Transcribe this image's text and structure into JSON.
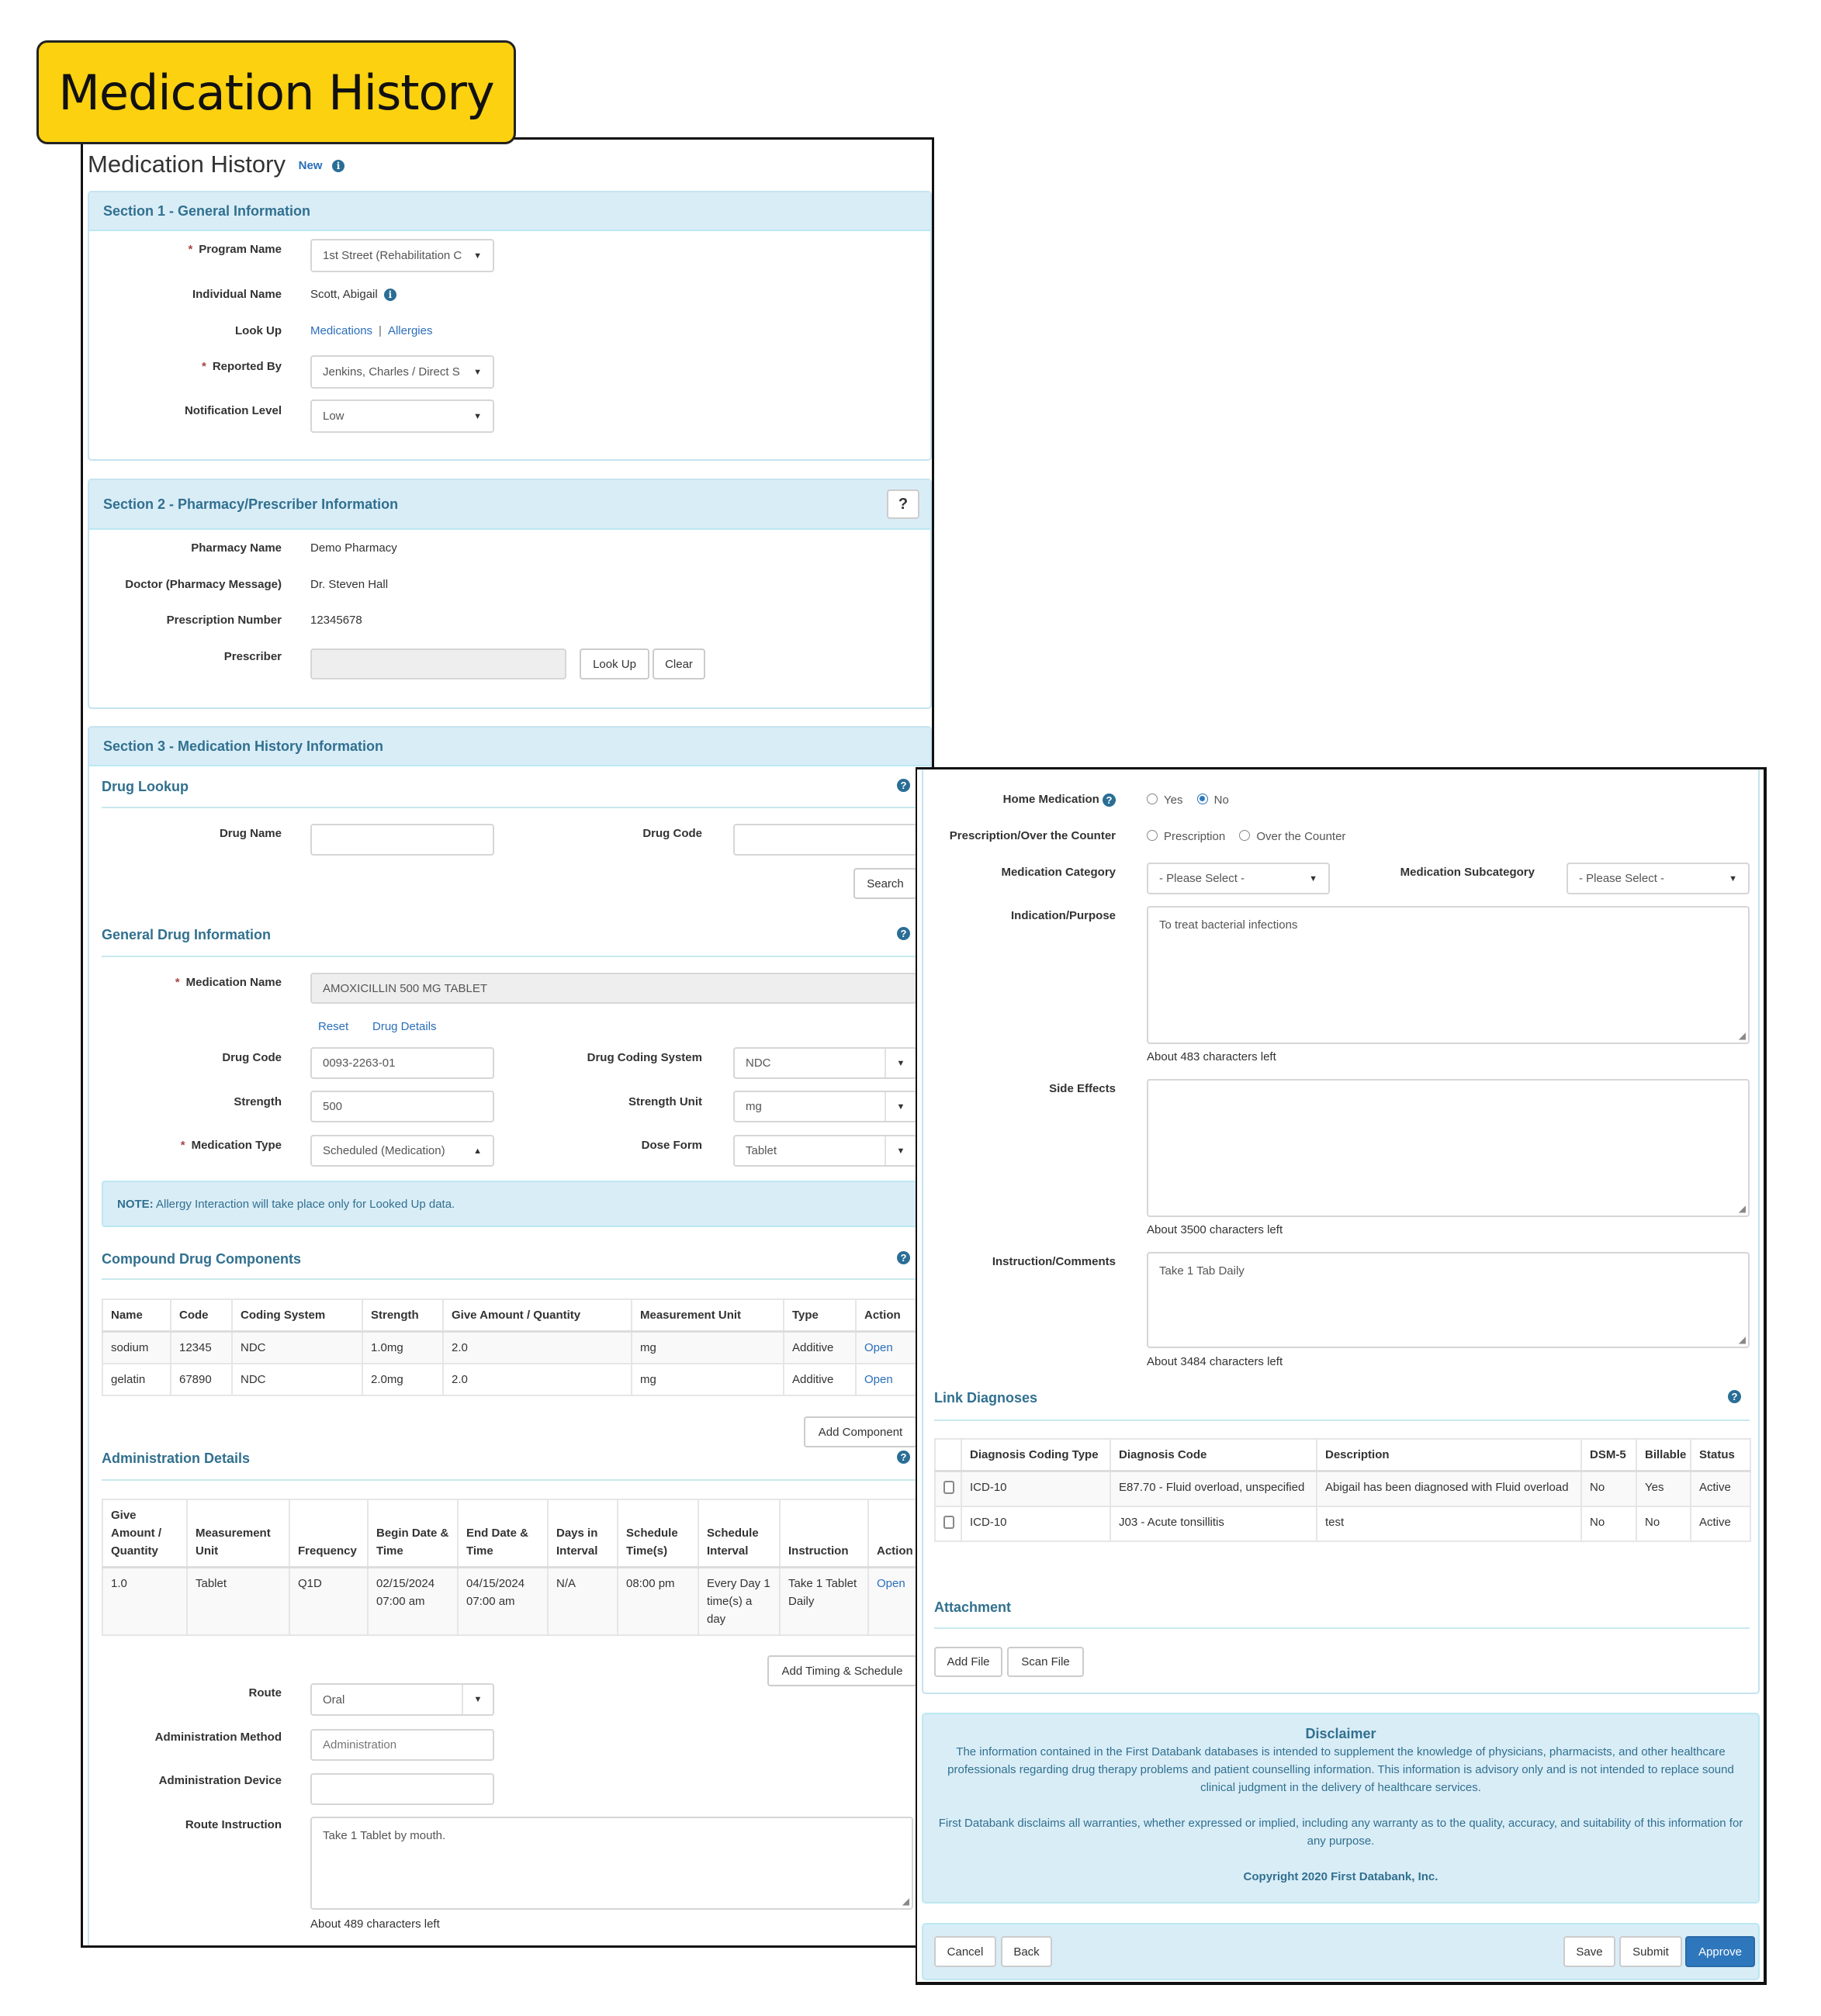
{
  "callout": {
    "title": "Medication History"
  },
  "page": {
    "title": "Medication History",
    "badge": "New"
  },
  "section1": {
    "title": "Section 1 - General Information",
    "program_name": {
      "label": "Program Name",
      "value": "1st Street (Rehabilitation C"
    },
    "individual_name": {
      "label": "Individual Name",
      "value": "Scott, Abigail"
    },
    "look_up": {
      "label": "Look Up",
      "links": [
        "Medications",
        "Allergies"
      ],
      "separator": "|"
    },
    "reported_by": {
      "label": "Reported By",
      "value": "Jenkins, Charles / Direct S"
    },
    "notification_level": {
      "label": "Notification Level",
      "value": "Low"
    }
  },
  "section2": {
    "title": "Section 2 - Pharmacy/Prescriber Information",
    "help_label": "?",
    "pharmacy_name": {
      "label": "Pharmacy Name",
      "value": "Demo Pharmacy"
    },
    "doctor": {
      "label": "Doctor (Pharmacy Message)",
      "value": "Dr. Steven Hall"
    },
    "prescription_number": {
      "label": "Prescription Number",
      "value": "12345678"
    },
    "prescriber": {
      "label": "Prescriber",
      "value": "",
      "lookup_button": "Look Up",
      "clear_button": "Clear"
    }
  },
  "section3": {
    "title": "Section 3 - Medication History Information",
    "drug_lookup": {
      "title": "Drug Lookup",
      "drug_name_label": "Drug Name",
      "drug_name_value": "",
      "drug_code_label": "Drug Code",
      "drug_code_value": "",
      "search_button": "Search"
    },
    "general": {
      "title": "General Drug Information",
      "medication_name": {
        "label": "Medication Name",
        "value": "AMOXICILLIN 500 MG TABLET"
      },
      "reset_link": "Reset",
      "drug_details_link": "Drug Details",
      "drug_code": {
        "label": "Drug Code",
        "value": "0093-2263-01"
      },
      "drug_coding_system": {
        "label": "Drug Coding System",
        "value": "NDC"
      },
      "strength": {
        "label": "Strength",
        "value": "500"
      },
      "strength_unit": {
        "label": "Strength Unit",
        "value": "mg"
      },
      "medication_type": {
        "label": "Medication Type",
        "value": "Scheduled (Medication)"
      },
      "dose_form": {
        "label": "Dose Form",
        "value": "Tablet"
      },
      "note_label": "NOTE:",
      "note_text": " Allergy Interaction will take place only for Looked Up data."
    },
    "compound": {
      "title": "Compound Drug Components",
      "columns": [
        "Name",
        "Code",
        "Coding System",
        "Strength",
        "Give Amount / Quantity",
        "Measurement Unit",
        "Type",
        "Action"
      ],
      "rows": [
        [
          "sodium",
          "12345",
          "NDC",
          "1.0mg",
          "2.0",
          "mg",
          "Additive",
          "Open"
        ],
        [
          "gelatin",
          "67890",
          "NDC",
          "2.0mg",
          "2.0",
          "mg",
          "Additive",
          "Open"
        ]
      ],
      "add_button": "Add Component"
    },
    "administration": {
      "title": "Administration Details",
      "columns": [
        "Give Amount / Quantity",
        "Measurement Unit",
        "Frequency",
        "Begin Date & Time",
        "End Date & Time",
        "Days in Interval",
        "Schedule Time(s)",
        "Schedule Interval",
        "Instruction",
        "Action"
      ],
      "rows": [
        [
          "1.0",
          "Tablet",
          "Q1D",
          "02/15/2024 07:00 am",
          "04/15/2024 07:00 am",
          "N/A",
          "08:00 pm",
          "Every Day 1 time(s) a day",
          "Take 1 Tablet Daily",
          "Open"
        ]
      ],
      "add_button": "Add Timing & Schedule",
      "route": {
        "label": "Route",
        "value": "Oral"
      },
      "method": {
        "label": "Administration Method",
        "value": "",
        "placeholder": "Administration"
      },
      "device": {
        "label": "Administration Device",
        "value": ""
      },
      "route_instruction": {
        "label": "Route Instruction",
        "value": "Take 1 Tablet by mouth."
      },
      "route_instruction_hint": "About 489 characters left"
    }
  },
  "right": {
    "home_medication": {
      "label": "Home Medication",
      "options": [
        "Yes",
        "No"
      ],
      "selected": "No"
    },
    "rx_otc": {
      "label": "Prescription/Over the Counter",
      "options": [
        "Prescription",
        "Over the Counter"
      ],
      "selected": null
    },
    "category": {
      "label": "Medication Category",
      "value": "- Please Select -"
    },
    "subcategory": {
      "label": "Medication Subcategory",
      "value": "- Please Select -"
    },
    "indication": {
      "label": "Indication/Purpose",
      "value": "To treat bacterial infections",
      "hint": "About 483 characters left"
    },
    "side_effects": {
      "label": "Side Effects",
      "value": "",
      "hint": "About 3500 characters left"
    },
    "instruction": {
      "label": "Instruction/Comments",
      "value": "Take 1 Tab Daily",
      "hint": "About 3484 characters left"
    },
    "diagnoses": {
      "title": "Link Diagnoses",
      "columns": [
        "",
        "Diagnosis Coding Type",
        "Diagnosis Code",
        "Description",
        "DSM-5",
        "Billable",
        "Status"
      ],
      "rows": [
        {
          "checked": false,
          "cells": [
            "ICD-10",
            "E87.70 - Fluid overload, unspecified",
            "Abigail has been diagnosed with Fluid overload",
            "No",
            "Yes",
            "Active"
          ]
        },
        {
          "checked": false,
          "cells": [
            "ICD-10",
            "J03 - Acute tonsillitis",
            "test",
            "No",
            "No",
            "Active"
          ]
        }
      ]
    },
    "attachment": {
      "title": "Attachment",
      "add_file": "Add File",
      "scan_file": "Scan File"
    },
    "disclaimer": {
      "title": "Disclaimer",
      "p1": "The information contained in the First Databank databases is intended to supplement the knowledge of physicians, pharmacists, and other healthcare professionals regarding drug therapy problems and patient counselling information. This information is advisory only and is not intended to replace sound clinical judgment in the delivery of healthcare services.",
      "p2": "First Databank disclaims all warranties, whether expressed or implied, including any warranty as to the quality, accuracy, and suitability of this information for any purpose.",
      "copyright": "Copyright 2020 First Databank, Inc."
    },
    "footer": {
      "cancel": "Cancel",
      "back": "Back",
      "save": "Save",
      "submit": "Submit",
      "approve": "Approve"
    }
  },
  "colors": {
    "callout": "#fcd10f",
    "panel_heading": "#d9edf7",
    "heading_text": "#31708f",
    "link": "#2a6ebb",
    "primary": "#2e77bc",
    "required": "#a94442"
  },
  "icons": {
    "info": "info-circle-icon",
    "help": "question-circle-icon",
    "caret": "caret-down-icon"
  }
}
